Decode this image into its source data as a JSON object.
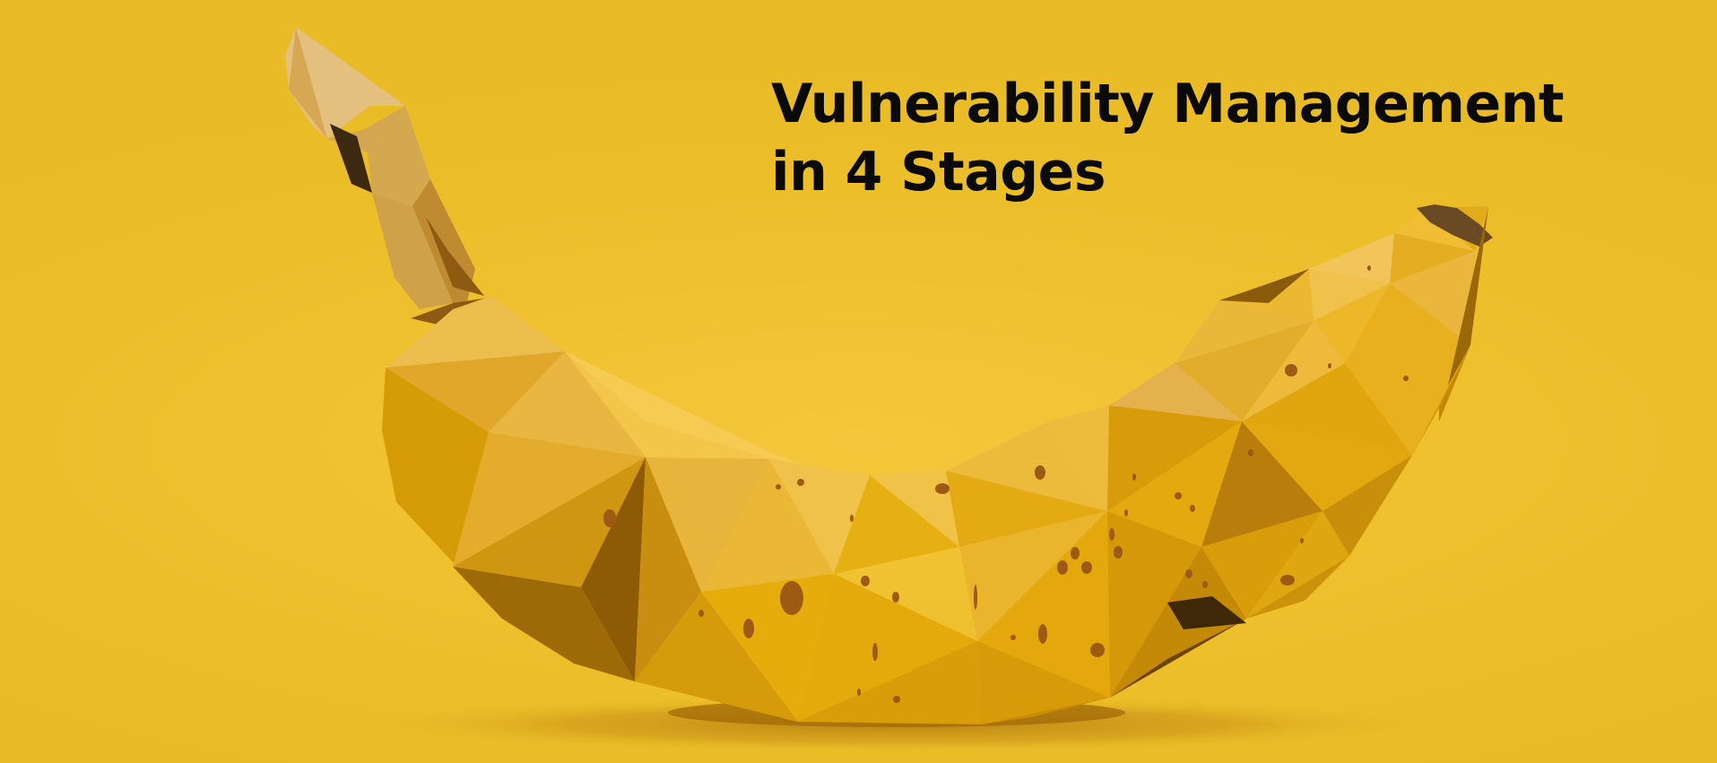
{
  "headline": {
    "line1": "Vulnerability Management",
    "line2": "in 4 Stages"
  },
  "illustration": {
    "subject": "banana-icon",
    "style": "low-poly"
  },
  "colors": {
    "background": "#efc12f",
    "headline_text": "#0a0a0a",
    "banana_light": "#f3c64a",
    "banana_mid": "#e0a710",
    "banana_dark": "#a06a08",
    "spots": "#9c5a12"
  }
}
